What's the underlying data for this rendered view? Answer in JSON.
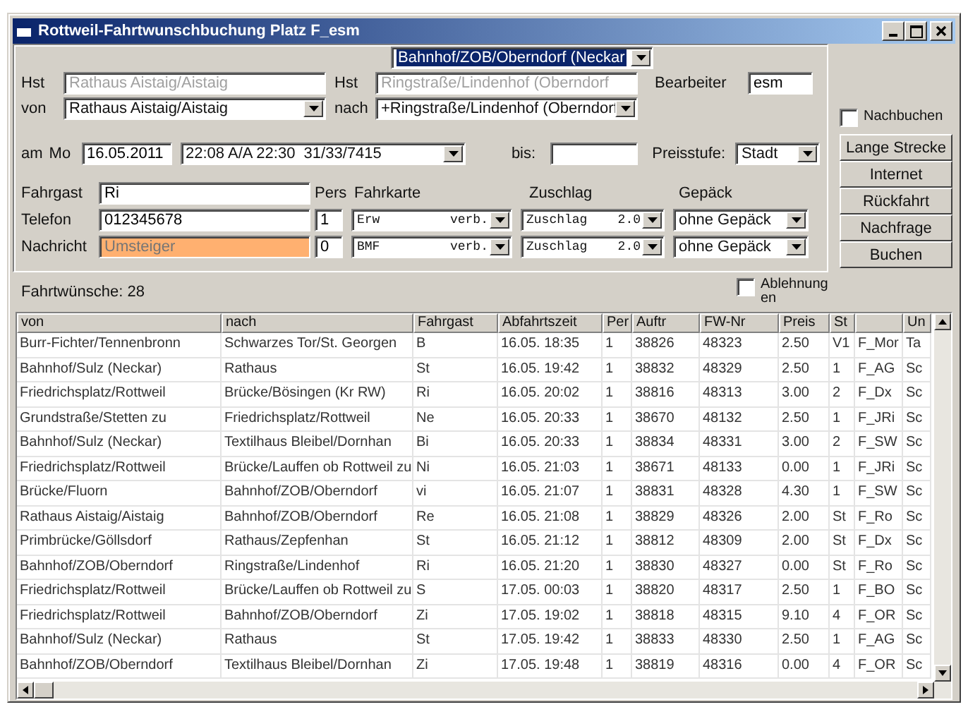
{
  "window": {
    "title": "Rottweil-Fahrtwunschbuchung Platz F_esm"
  },
  "selected_stop": "Bahnhof/ZOB/Oberndorf (Neckar",
  "stop_fields": [
    {
      "label": "Hst",
      "value": "Rathaus Aistaig/Aistaig",
      "disabled": true
    },
    {
      "label": "Hst",
      "value": "Ringstraße/Lindenhof (Oberndorf",
      "disabled": true
    }
  ],
  "route_combos": [
    {
      "label": "von",
      "value": "Rathaus Aistaig/Aistaig"
    },
    {
      "label": "nach",
      "value": "+Ringstraße/Lindenhof (Oberndorf"
    }
  ],
  "editor": {
    "label": "Bearbeiter",
    "value": "esm"
  },
  "rebook": {
    "label": "Nachbuchen",
    "checked": false
  },
  "date_row": {
    "label": "am",
    "weekday": "Mo",
    "date": "16.05.2011",
    "trip": "22:08 A/A 22:30  31/33/7415",
    "until_label": "bis:"
  },
  "price_level": {
    "label": "Preisstufe:",
    "value": "Stadt"
  },
  "passenger_fields": [
    {
      "label": "Fahrgast",
      "value": "Ri",
      "kind": "value"
    },
    {
      "label": "Telefon",
      "value": "012345678",
      "kind": "value"
    },
    {
      "label": "Nachricht",
      "placeholder": "Umsteiger",
      "kind": "note"
    }
  ],
  "ticket_headers": [
    "Pers",
    "Fahrkarte",
    "Zuschlag",
    "Gepäck"
  ],
  "ticket_rows": [
    {
      "persons": "1",
      "ticket": "Erw",
      "ticket_mode": "verb.",
      "surcharge": "Zuschlag",
      "surcharge_amount": "2.0",
      "luggage": "ohne Gepäck"
    },
    {
      "persons": "0",
      "ticket": "BMF",
      "ticket_mode": "verb.",
      "surcharge": "Zuschlag",
      "surcharge_amount": "2.0",
      "luggage": "ohne Gepäck"
    }
  ],
  "buttons": [
    "Lange Strecke",
    "Internet",
    "Rückfahrt",
    "Nachfrage",
    "Buchen"
  ],
  "rejections": {
    "label": "Ablehnungen",
    "checked": false
  },
  "wishes_label": "Fahrtwünsche: 28",
  "table": {
    "columns": [
      "von",
      "nach",
      "Fahrgast",
      "Abfahrtszeit",
      "Per",
      "Auftr",
      "FW-Nr",
      "Preis",
      "St",
      "",
      "Un"
    ],
    "rows": [
      [
        "Burr-Fichter/Tennenbronn",
        "Schwarzes Tor/St. Georgen",
        "B",
        "16.05.  18:35",
        "1",
        "38826",
        "48323",
        "2.50",
        "V1",
        "F_Mor",
        "Ta"
      ],
      [
        "Bahnhof/Sulz (Neckar)",
        "Rathaus",
        "St",
        "16.05.  19:42",
        "1",
        "38832",
        "48329",
        "2.50",
        "1",
        "F_AG",
        "Sc"
      ],
      [
        "Friedrichsplatz/Rottweil",
        "Brücke/Bösingen (Kr RW)",
        "Ri",
        "16.05.  20:02",
        "1",
        "38816",
        "48313",
        "3.00",
        "2",
        "F_Dx",
        "Sc"
      ],
      [
        "Grundstraße/Stetten zu",
        "Friedrichsplatz/Rottweil",
        "Ne",
        "16.05.  20:33",
        "1",
        "38670",
        "48132",
        "2.50",
        "1",
        "F_JRi",
        "Sc"
      ],
      [
        "Bahnhof/Sulz (Neckar)",
        "Textilhaus Bleibel/Dornhan",
        "Bi",
        "16.05.  20:33",
        "1",
        "38834",
        "48331",
        "3.00",
        "2",
        "F_SW",
        "Sc"
      ],
      [
        "Friedrichsplatz/Rottweil",
        "Brücke/Lauffen ob Rottweil zu",
        "Ni",
        "16.05.  21:03",
        "1",
        "38671",
        "48133",
        "0.00",
        "1",
        "F_JRi",
        "Sc"
      ],
      [
        "Brücke/Fluorn",
        "Bahnhof/ZOB/Oberndorf",
        "vi",
        "16.05.  21:07",
        "1",
        "38831",
        "48328",
        "4.30",
        "1",
        "F_SW",
        "Sc"
      ],
      [
        "Rathaus Aistaig/Aistaig",
        "Bahnhof/ZOB/Oberndorf",
        "Re",
        "16.05.  21:08",
        "1",
        "38829",
        "48326",
        "2.00",
        "St",
        "F_Ro",
        "Sc"
      ],
      [
        "Primbrücke/Göllsdorf",
        "Rathaus/Zepfenhan",
        "St",
        "16.05.  21:12",
        "1",
        "38812",
        "48309",
        "2.00",
        "St",
        "F_Dx",
        "Sc"
      ],
      [
        "Bahnhof/ZOB/Oberndorf",
        "Ringstraße/Lindenhof",
        "Ri",
        "16.05.  21:20",
        "1",
        "38830",
        "48327",
        "0.00",
        "St",
        "F_Ro",
        "Sc"
      ],
      [
        "Friedrichsplatz/Rottweil",
        "Brücke/Lauffen ob Rottweil zu",
        "S",
        "17.05.  00:03",
        "1",
        "38820",
        "48317",
        "2.50",
        "1",
        "F_BO",
        "Sc"
      ],
      [
        "Friedrichsplatz/Rottweil",
        "Bahnhof/ZOB/Oberndorf",
        "Zi",
        "17.05.  19:02",
        "1",
        "38818",
        "48315",
        "9.10",
        "4",
        "F_OR",
        "Sc"
      ],
      [
        "Bahnhof/Sulz (Neckar)",
        "Rathaus",
        "St",
        "17.05.  19:42",
        "1",
        "38833",
        "48330",
        "2.50",
        "1",
        "F_AG",
        "Sc"
      ],
      [
        "Bahnhof/ZOB/Oberndorf",
        "Textilhaus Bleibel/Dornhan",
        "Zi",
        "17.05.  19:48",
        "1",
        "38819",
        "48316",
        "0.00",
        "4",
        "F_OR",
        "Sc"
      ]
    ]
  }
}
